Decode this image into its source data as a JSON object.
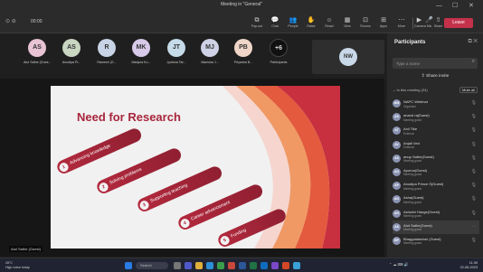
{
  "window": {
    "title": "Meeting in \"General\"",
    "controls": [
      "—",
      "☐",
      "✕"
    ]
  },
  "toolbar": {
    "timer": "00:00",
    "buttons": [
      {
        "label": "Pop-out",
        "icon": "popout-icon",
        "glyph": "⧉"
      },
      {
        "label": "Chat",
        "icon": "chat-icon",
        "glyph": "💬"
      },
      {
        "label": "People",
        "icon": "people-icon",
        "glyph": "👥"
      },
      {
        "label": "Raise",
        "icon": "raise-hand-icon",
        "glyph": "✋"
      },
      {
        "label": "React",
        "icon": "react-icon",
        "glyph": "☺"
      },
      {
        "label": "View",
        "icon": "view-icon",
        "glyph": "▦"
      },
      {
        "label": "Rooms",
        "icon": "rooms-icon",
        "glyph": "⊡"
      },
      {
        "label": "Apps",
        "icon": "apps-icon",
        "glyph": "⊞"
      },
      {
        "label": "More",
        "icon": "more-icon",
        "glyph": "⋯"
      },
      {
        "label": "Camera",
        "icon": "camera-icon",
        "glyph": "▶"
      },
      {
        "label": "Mic",
        "icon": "mic-icon",
        "glyph": "🎤"
      },
      {
        "label": "Share",
        "icon": "share-icon",
        "glyph": "⇧"
      }
    ],
    "leave_label": "Leave"
  },
  "strip": {
    "tiles": [
      {
        "initials": "AS",
        "name": "Atul Sathe (Gues...",
        "color": "#e7c3d3"
      },
      {
        "initials": "AS",
        "name": "Anudipa Pr...",
        "color": "#c8d6c2"
      },
      {
        "initials": "R",
        "name": "Ramesh (G...",
        "color": "#c8d4e6"
      },
      {
        "initials": "MK",
        "name": "Manjula Ku...",
        "color": "#d7c9e8"
      },
      {
        "initials": "JT",
        "name": "Jyotsna Tat...",
        "color": "#c6dbe8"
      },
      {
        "initials": "MJ",
        "name": "Manisha J...",
        "color": "#cfd2e6"
      },
      {
        "initials": "PB",
        "name": "Priyanka B...",
        "color": "#f0d6c8"
      },
      {
        "initials": "+6",
        "name": "Participants",
        "color": "#111111"
      }
    ],
    "self_initials": "NW"
  },
  "slide": {
    "title": "Need for Research",
    "items": [
      {
        "num": "1",
        "text": "Advancing knowledge"
      },
      {
        "num": "2",
        "text": "Solving problems"
      },
      {
        "num": "3",
        "text": "Supporting teaching"
      },
      {
        "num": "4",
        "text": "Career advancement"
      },
      {
        "num": "5",
        "text": "Funding"
      }
    ],
    "presenter": "Atul Sathe (Guest)"
  },
  "panel": {
    "title": "Participants",
    "search_placeholder": "Type a name",
    "share_label": "Share invite",
    "section_label": "In this meeting (24)",
    "mute_all": "Mute all",
    "people": [
      {
        "initials": "NW",
        "name": "NAPC Webinar",
        "role": "Organiser"
      },
      {
        "initials": "AS",
        "name": "anand rajGuest)",
        "role": "Meeting guest"
      },
      {
        "initials": "AT",
        "name": "Anil Tike",
        "role": "External"
      },
      {
        "initials": "AV",
        "name": "Anjali Ved",
        "role": "External"
      },
      {
        "initials": "AS",
        "name": "anup Sathe(Guest)",
        "role": "Meeting guest"
      },
      {
        "initials": "AG",
        "name": "Apurva(Guest)",
        "role": "Meeting guest"
      },
      {
        "initials": "AP",
        "name": "Anudipa Prince S(Guest)",
        "role": "Meeting guest"
      },
      {
        "initials": "AG",
        "name": "Asha(Guest)",
        "role": "Meeting guest"
      },
      {
        "initials": "AH",
        "name": "Ashwini Hange(Guest)",
        "role": "Meeting guest"
      },
      {
        "initials": "AS",
        "name": "Atul Sathe(Guest)",
        "role": "Meeting guest"
      },
      {
        "initials": "BP",
        "name": "Bhagyalakshmi (Guest)",
        "role": "Meeting guest"
      }
    ]
  },
  "taskbar": {
    "weather_temp": "28°C",
    "weather_desc": "High noise today",
    "search_label": "Search",
    "time": "11:39",
    "date": "22-06-2023"
  },
  "colors": {
    "accent": "#a8263c",
    "leave": "#c4314b"
  }
}
